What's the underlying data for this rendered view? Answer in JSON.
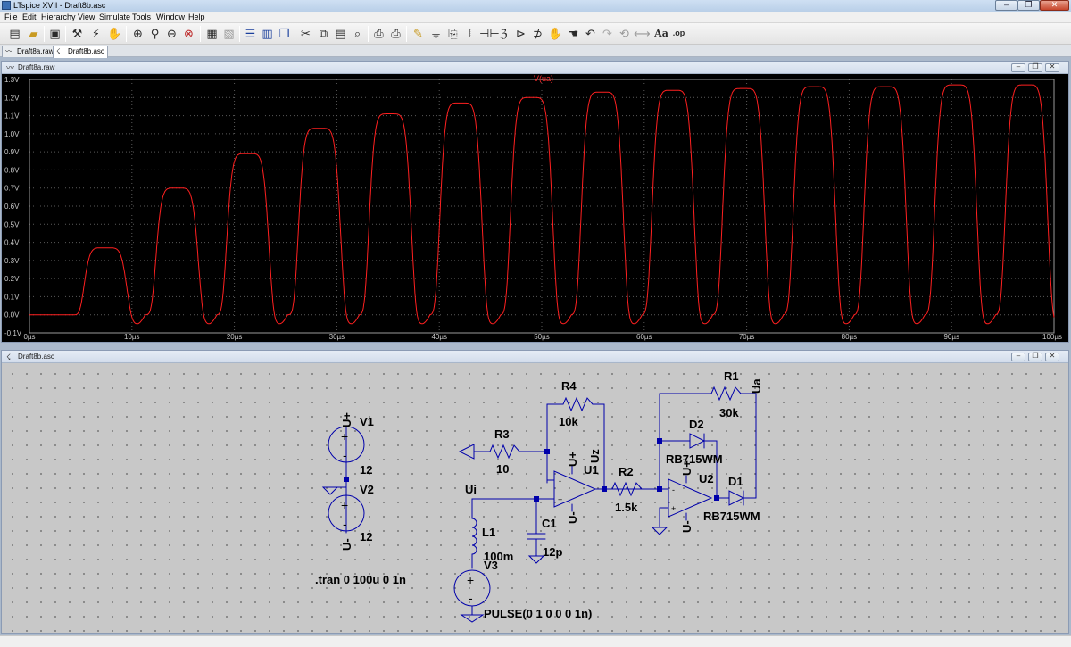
{
  "window": {
    "title": "LTspice XVII - Draft8b.asc"
  },
  "menu": {
    "items": [
      "File",
      "Edit",
      "Hierarchy",
      "View",
      "Simulate",
      "Tools",
      "Window",
      "Help"
    ]
  },
  "toolbar": {
    "text_tool_label": "Aa",
    "spice_directive_label": ".op"
  },
  "tabs": [
    {
      "label": "Draft8a.raw"
    },
    {
      "label": "Draft8b.asc"
    }
  ],
  "plot_window": {
    "title": "Draft8a.raw"
  },
  "schematic_window": {
    "title": "Draft8b.asc"
  },
  "chart_data": {
    "type": "line",
    "series": [
      {
        "name": "V(ua)",
        "color": "#ff2020"
      }
    ],
    "xlim": [
      0,
      100
    ],
    "x_unit": "µs",
    "ylim": [
      -0.1,
      1.3
    ],
    "y_unit": "V",
    "x_ticks": [
      "0µs",
      "10µs",
      "20µs",
      "30µs",
      "40µs",
      "50µs",
      "60µs",
      "70µs",
      "80µs",
      "90µs",
      "100µs"
    ],
    "y_ticks": [
      "-0.1V",
      "0.0V",
      "0.1V",
      "0.2V",
      "0.3V",
      "0.4V",
      "0.5V",
      "0.6V",
      "0.7V",
      "0.8V",
      "0.9V",
      "1.0V",
      "1.1V",
      "1.2V",
      "1.3V"
    ],
    "grid": true,
    "peaks": [
      {
        "t": 7.4,
        "v": 0.37
      },
      {
        "t": 14.4,
        "v": 0.7
      },
      {
        "t": 21.3,
        "v": 0.89
      },
      {
        "t": 28.3,
        "v": 1.03
      },
      {
        "t": 35.2,
        "v": 1.11
      },
      {
        "t": 42.1,
        "v": 1.17
      },
      {
        "t": 49.0,
        "v": 1.2
      },
      {
        "t": 55.9,
        "v": 1.23
      },
      {
        "t": 62.8,
        "v": 1.24
      },
      {
        "t": 69.7,
        "v": 1.25
      },
      {
        "t": 76.6,
        "v": 1.26
      },
      {
        "t": 83.5,
        "v": 1.26
      },
      {
        "t": 90.4,
        "v": 1.27
      },
      {
        "t": 97.3,
        "v": 1.27
      }
    ],
    "baseline_v": 0.0,
    "undershoot_v": -0.05
  },
  "schematic": {
    "components": {
      "V1": {
        "name": "V1",
        "value": "12"
      },
      "V2": {
        "name": "V2",
        "value": "12"
      },
      "V3": {
        "name": "V3",
        "value": "PULSE(0 1 0 0 0 1n)"
      },
      "R1": {
        "name": "R1",
        "value": "30k"
      },
      "R2": {
        "name": "R2",
        "value": "1.5k"
      },
      "R3": {
        "name": "R3",
        "value": "10"
      },
      "R4": {
        "name": "R4",
        "value": "10k"
      },
      "C1": {
        "name": "C1",
        "value": "12p"
      },
      "L1": {
        "name": "L1",
        "value": "100m"
      },
      "U1": {
        "name": "U1"
      },
      "U2": {
        "name": "U2"
      },
      "D1": {
        "name": "D1",
        "value": "RB715WM"
      },
      "D2": {
        "name": "D2",
        "value": "RB715WM"
      }
    },
    "net_labels": {
      "u_plus_1": "U+",
      "u_minus_1": "U-",
      "u_plus_2": "U+",
      "u_minus_2": "U-",
      "u_plus_3": "U+",
      "u_minus_3": "U-",
      "ui": "Ui",
      "uz": "Uz",
      "ua": "Ua"
    },
    "directive": ".tran 0 100u 0 1n"
  }
}
